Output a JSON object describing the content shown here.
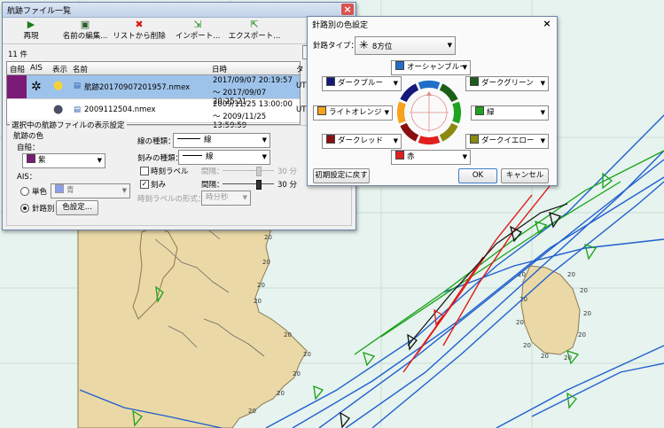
{
  "map": {
    "depth_labels": [
      "20",
      "20",
      "20",
      "20",
      "20",
      "20",
      "20",
      "20",
      "20",
      "20",
      "20",
      "20",
      "20",
      "20",
      "20",
      "20",
      "20",
      "20",
      "20",
      "20"
    ]
  },
  "track_window": {
    "title": "航跡ファイル一覧",
    "toolbar": {
      "play": "再現",
      "edit_name": "名前の編集...",
      "remove": "リストから削除",
      "import": "インポート...",
      "export": "エクスポート..."
    },
    "count": "11 件",
    "columns": [
      "自船",
      "AIS",
      "表示",
      "名前",
      "日時",
      "タ"
    ],
    "rows": [
      {
        "name": "航跡20170907201957.nmex",
        "date1": "2017/09/07 20:19:57",
        "date2": "～ 2017/09/07 20:25:21",
        "extra": "UT",
        "selected": true,
        "color": "#7b1a78"
      },
      {
        "name": "2009112504.nmex",
        "date1": "2009/11/25 13:00:00",
        "date2": "～ 2009/11/25 13:59:59",
        "extra": "UT",
        "selected": false,
        "color": ""
      }
    ],
    "settings": {
      "group_title": "選択中の航跡ファイルの表示設定",
      "track_color_label": "航跡の色",
      "own_ship_label": "自船：",
      "own_ship_value": "紫",
      "ais_label": "AIS：",
      "single_color_label": "単色",
      "single_color_value": "青",
      "per_course_label": "針路別",
      "color_settings_button": "色設定...",
      "line_type_label": "線の種類：",
      "line_type_value": "線",
      "tick_type_label": "刻みの種類：",
      "tick_type_value": "線",
      "time_label_label": "時刻ラベル",
      "time_label_interval_label": "間隔：",
      "time_label_interval_value": "30 分",
      "tick_label": "刻み",
      "tick_interval_label": "間隔：",
      "tick_interval_value": "30 分",
      "time_format_label": "時刻ラベルの形式：",
      "time_format_value": "時分秒"
    }
  },
  "color_window": {
    "title": "針路別の色設定",
    "course_type_label": "針路タイプ：",
    "course_type_value": "8方位",
    "colors": {
      "top": {
        "label": "オーシャンブルー",
        "hex": "#1f6fc9"
      },
      "upper_left": {
        "label": "ダークブルー",
        "hex": "#131a7a"
      },
      "upper_right": {
        "label": "ダークグリーン",
        "hex": "#1a5e18"
      },
      "left": {
        "label": "ライトオレンジ",
        "hex": "#f7a21b"
      },
      "right": {
        "label": "緑",
        "hex": "#1fa31f"
      },
      "lower_left": {
        "label": "ダークレッド",
        "hex": "#8a0f0f"
      },
      "lower_right": {
        "label": "ダークイエロー",
        "hex": "#8a8a10"
      },
      "bottom": {
        "label": "赤",
        "hex": "#e11f1f"
      }
    },
    "reset_button": "初期設定に戻す",
    "ok_button": "OK",
    "cancel_button": "キャンセル"
  }
}
